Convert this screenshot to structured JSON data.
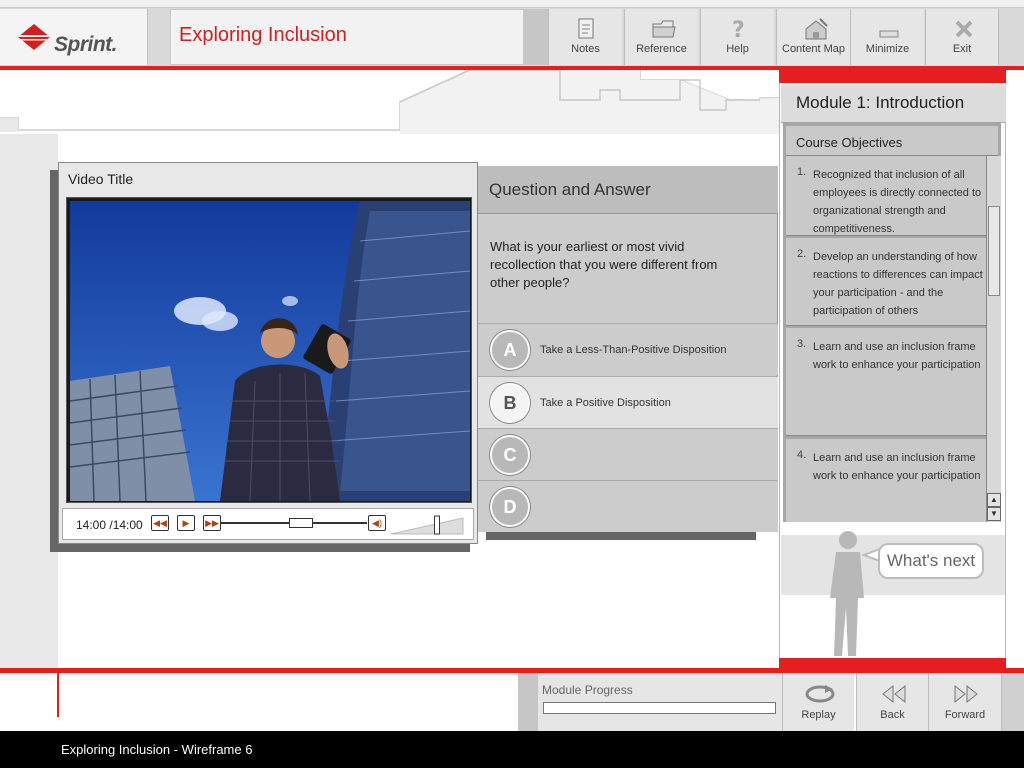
{
  "app": {
    "brand": "Sprint.",
    "course_title": "Exploring Inclusion"
  },
  "toolbar": [
    {
      "label": "Notes",
      "icon": "notes-icon"
    },
    {
      "label": "Reference",
      "icon": "folder-icon"
    },
    {
      "label": "Help",
      "icon": "help-icon"
    },
    {
      "label": "Content Map",
      "icon": "content-map-icon"
    },
    {
      "label": "Minimize",
      "icon": "minimize-icon"
    },
    {
      "label": "Exit",
      "icon": "close-icon"
    }
  ],
  "video": {
    "title": "Video Title",
    "time": "14:00 /14:00",
    "position": 0.55,
    "volume": 0.7
  },
  "qa": {
    "title": "Question and Answer",
    "question": "What is your earliest or most vivid recollection that you were different from other people?",
    "options": [
      {
        "letter": "A",
        "text": "Take a Less-Than-Positive Disposition"
      },
      {
        "letter": "B",
        "text": "Take a Positive Disposition"
      },
      {
        "letter": "C",
        "text": ""
      },
      {
        "letter": "D",
        "text": ""
      }
    ],
    "selected": "B"
  },
  "module": {
    "title": "Module 1: Introduction",
    "objectives_title": "Course Objectives",
    "objectives": [
      {
        "num": "1.",
        "text": "Recognized that inclusion of all employees is directly connected to organizational strength and competitiveness."
      },
      {
        "num": "2.",
        "text": "Develop an understanding of how reactions to differences can impact your participation - and the participation of others"
      },
      {
        "num": "3.",
        "text": "Learn and use an inclusion frame work to enhance your participation"
      },
      {
        "num": "4.",
        "text": "Learn and use an inclusion frame work to enhance your participation"
      }
    ],
    "whats_next": "What's next"
  },
  "bottom": {
    "progress_label": "Module Progress",
    "progress": 0,
    "buttons": [
      {
        "label": "Replay",
        "icon": "replay-icon"
      },
      {
        "label": "Back",
        "icon": "back-icon"
      },
      {
        "label": "Forward",
        "icon": "forward-icon"
      }
    ]
  },
  "footer": {
    "text": "Exploring Inclusion - Wireframe 6"
  },
  "colors": {
    "accent": "#e61e1e",
    "title_red": "#d21f1f"
  }
}
